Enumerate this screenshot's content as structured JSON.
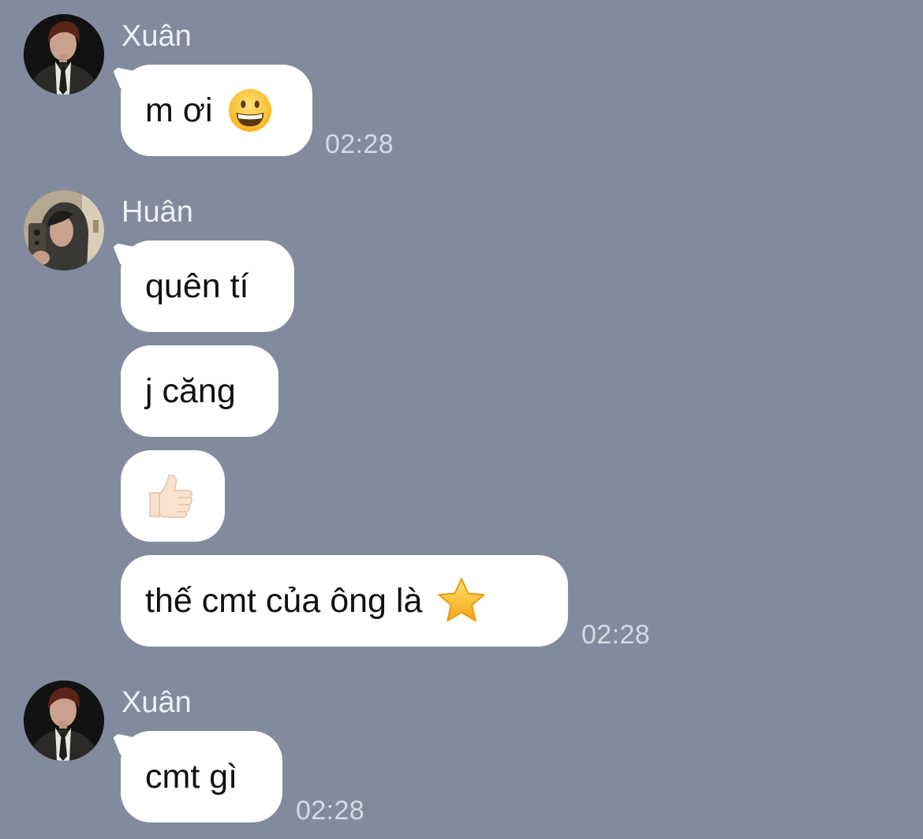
{
  "theme": {
    "background": "#818b9d",
    "bubble": "#ffffff",
    "meta_text": "#d4d9e3"
  },
  "chat": {
    "groups": [
      {
        "sender": "Xuân",
        "avatar": "avatar-xuan",
        "messages": [
          {
            "text": "m ơi",
            "emoji": "grinning-face-emoji"
          }
        ],
        "time": "02:28"
      },
      {
        "sender": "Huân",
        "avatar": "avatar-huan",
        "messages": [
          {
            "text": "quên tí"
          },
          {
            "text": "j căng"
          },
          {
            "text": "",
            "emoji": "thumbs-up-emoji"
          },
          {
            "text": "thế cmt của ông là",
            "emoji": "star-emoji"
          }
        ],
        "time": "02:28"
      },
      {
        "sender": "Xuân",
        "avatar": "avatar-xuan",
        "messages": [
          {
            "text": "cmt gì"
          }
        ],
        "time": "02:28"
      }
    ]
  }
}
